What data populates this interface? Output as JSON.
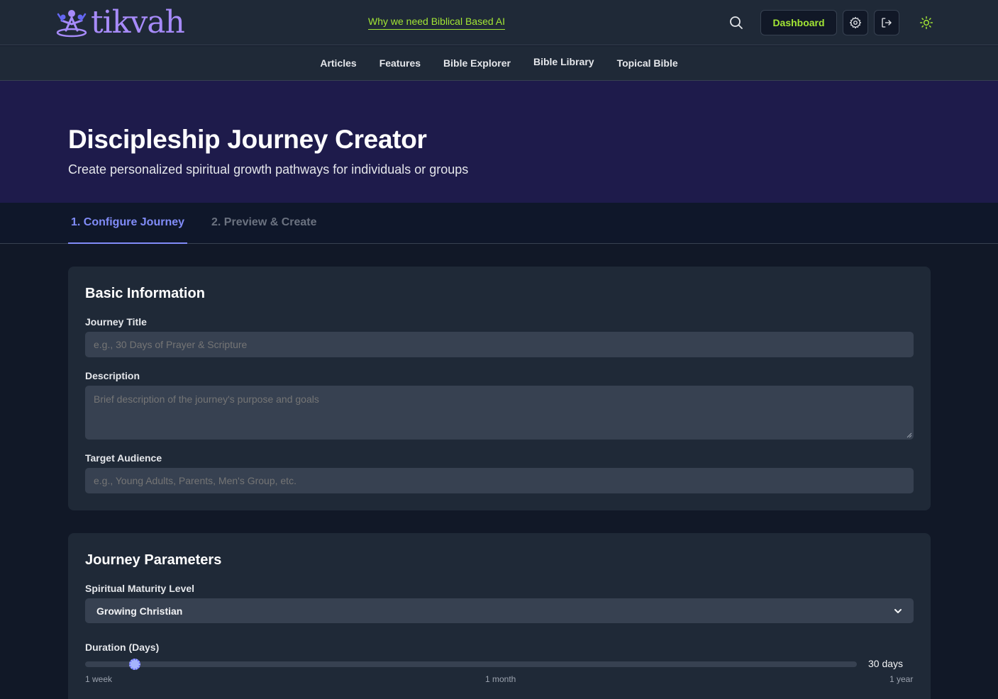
{
  "header": {
    "logo_text": "tikvah",
    "why_link": "Why we need Biblical Based AI",
    "dashboard_label": "Dashboard"
  },
  "nav": {
    "items": [
      "Articles",
      "Features",
      "Bible Explorer",
      "Bible Library",
      "Topical Bible"
    ]
  },
  "hero": {
    "title": "Discipleship Journey Creator",
    "subtitle": "Create personalized spiritual growth pathways for individuals or groups"
  },
  "tabs": [
    {
      "label": "1. Configure Journey",
      "active": true
    },
    {
      "label": "2. Preview & Create",
      "active": false
    }
  ],
  "basic_info": {
    "heading": "Basic Information",
    "title_label": "Journey Title",
    "title_placeholder": "e.g., 30 Days of Prayer & Scripture",
    "title_value": "",
    "description_label": "Description",
    "description_placeholder": "Brief description of the journey's purpose and goals",
    "description_value": "",
    "audience_label": "Target Audience",
    "audience_placeholder": "e.g., Young Adults, Parents, Men's Group, etc.",
    "audience_value": ""
  },
  "parameters": {
    "heading": "Journey Parameters",
    "maturity_label": "Spiritual Maturity Level",
    "maturity_value": "Growing Christian",
    "duration_label": "Duration (Days)",
    "duration_value_text": "30 days",
    "duration_days": 30,
    "duration_min_days": 7,
    "duration_max_days": 365,
    "tick_min": "1 week",
    "tick_mid": "1 month",
    "tick_max": "1 year"
  },
  "colors": {
    "accent": "#818cf8",
    "lime": "#a3e635",
    "hero_bg": "#1e1b4b",
    "card_bg": "#1f2937"
  },
  "icons": {
    "search": "search-icon",
    "settings": "gear-icon",
    "logout": "logout-icon",
    "theme": "sun-icon"
  }
}
